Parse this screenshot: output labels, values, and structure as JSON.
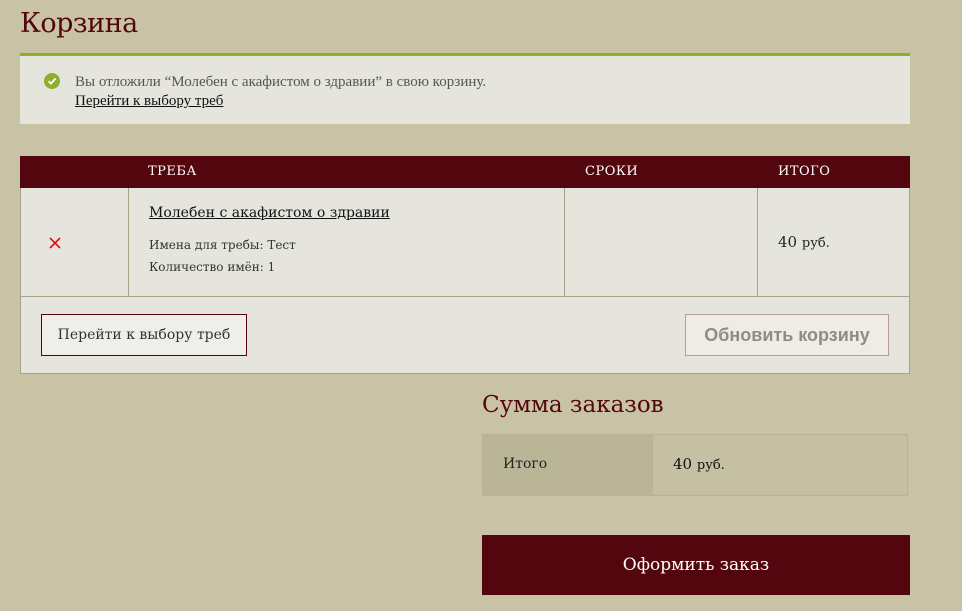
{
  "page": {
    "title": "Корзина"
  },
  "notice": {
    "message": "Вы отложили “Молебен с акафистом о здравии” в свою корзину.",
    "link": "Перейти к выбору треб",
    "icon": "check-circle-icon",
    "accent": "#8fae2b"
  },
  "cart": {
    "headers": {
      "treba": "ТРЕБА",
      "sroki": "СРОКИ",
      "itogo": "ИТОГО"
    },
    "items": [
      {
        "name": "Молебен с акафистом о здравии",
        "names_line": "Имена для требы: Тест",
        "count_line": "Количество имён: 1",
        "term": "",
        "total_amount": "40",
        "total_currency": "руб."
      }
    ],
    "choose_button": "Перейти к выбору треб",
    "update_button": "Обновить корзину"
  },
  "totals": {
    "title": "Сумма заказов",
    "label": "Итого",
    "amount": "40",
    "currency": "руб."
  },
  "checkout": {
    "label": "Оформить заказ"
  },
  "colors": {
    "background": "#c9c3a6",
    "brand": "#54060e",
    "panel": "#e6e5dd",
    "remove": "#e0101a"
  }
}
